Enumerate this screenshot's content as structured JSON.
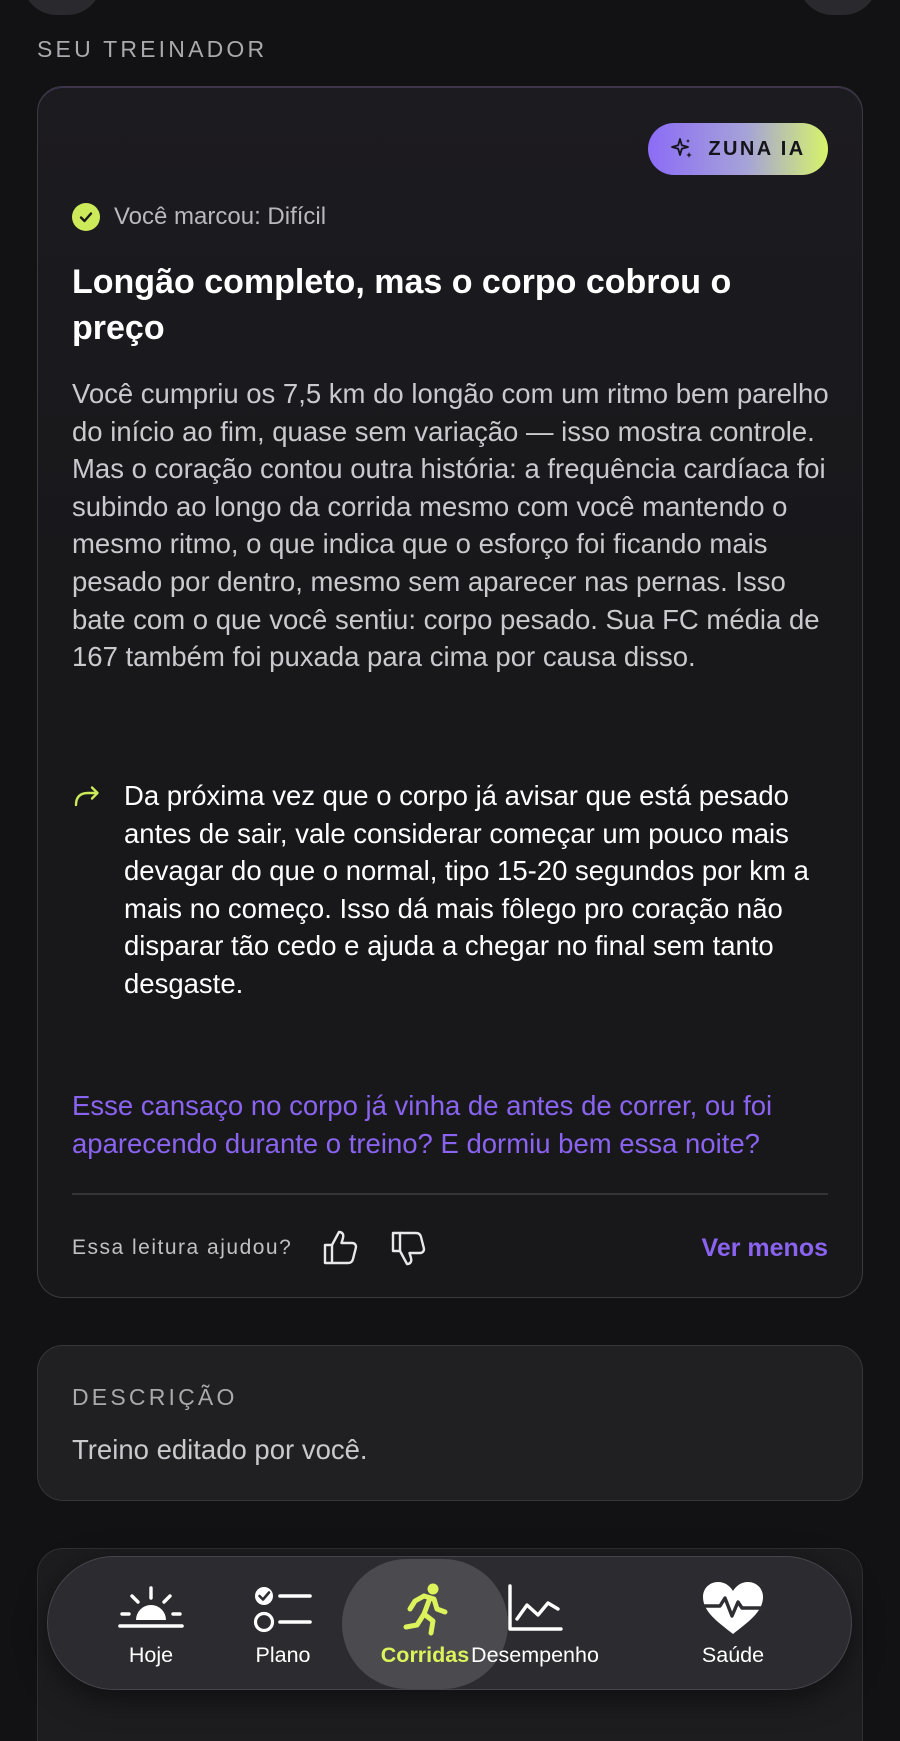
{
  "section_title": "SEU TREINADOR",
  "coach": {
    "badge_label": "ZUNA IA",
    "marked_text": "Você marcou: Difícil",
    "title": "Longão completo, mas o corpo cobrou o preço",
    "body": "Você cumpriu os 7,5 km do longão com um ritmo bem parelho do início ao fim, quase sem variação — isso mostra controle. Mas o coração contou outra história: a frequência cardíaca foi subindo ao longo da corrida mesmo com você mantendo o mesmo ritmo, o que indica que o esforço foi ficando mais pesado por dentro, mesmo sem aparecer nas pernas. Isso bate com o que você sentiu: corpo pesado. Sua FC média de 167 também foi puxada para cima por causa disso.",
    "tip": "Da próxima vez que o corpo já avisar que está pesado antes de sair, vale considerar começar um pouco mais devagar do que o normal, tipo 15-20 segundos por km a mais no começo. Isso dá mais fôlego pro coração não disparar tão cedo e ajuda a chegar no final sem tanto desgaste.",
    "question": "Esse cansaço no corpo já vinha de antes de correr, ou foi aparecendo durante o treino? E dormiu bem essa noite?",
    "feedback_label": "Essa leitura ajudou?",
    "see_less": "Ver menos"
  },
  "description": {
    "label": "DESCRIÇÃO",
    "text": "Treino editado por você."
  },
  "tabs": [
    {
      "label": "Hoje",
      "icon": "sunrise-icon"
    },
    {
      "label": "Plano",
      "icon": "checklist-icon"
    },
    {
      "label": "Corridas",
      "icon": "runner-icon",
      "active": true
    },
    {
      "label": "Desempenho",
      "icon": "line-chart-icon"
    },
    {
      "label": "Saúde",
      "icon": "heart-pulse-icon"
    }
  ],
  "colors": {
    "accent_purple": "#8a63f0",
    "accent_lime": "#dcf35b",
    "background": "#121214"
  }
}
